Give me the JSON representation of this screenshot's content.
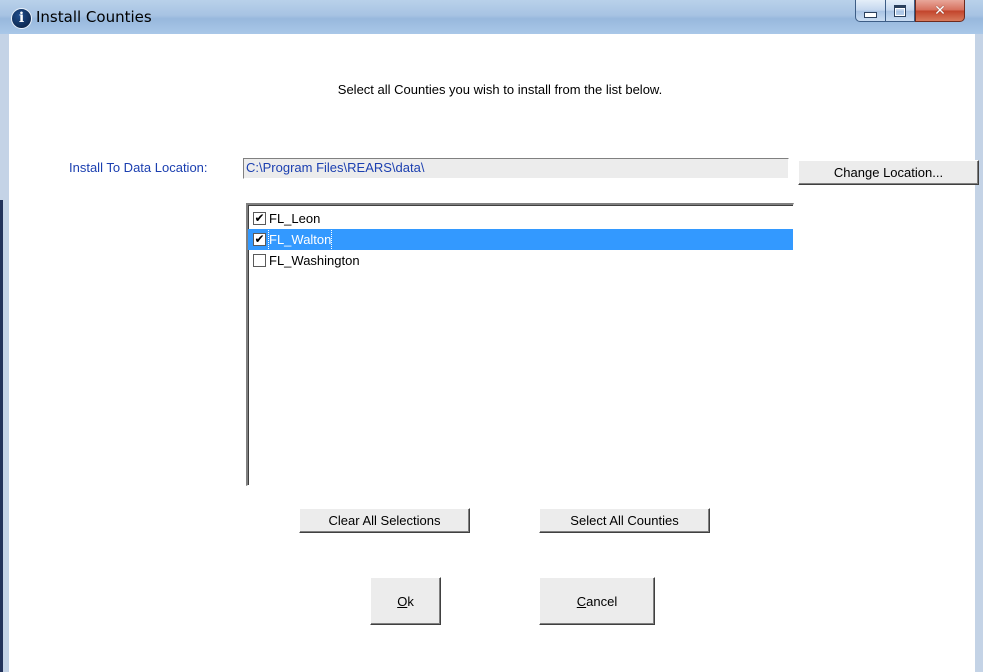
{
  "window": {
    "title": "Install Counties"
  },
  "instruction": "Select all Counties you wish to install from the list below.",
  "location": {
    "label": "Install To Data Location:",
    "value": "C:\\Program Files\\REARS\\data\\",
    "change_button": "Change Location..."
  },
  "counties": [
    {
      "label": "FL_Leon",
      "checked": true,
      "selected": false
    },
    {
      "label": "FL_Walton",
      "checked": true,
      "selected": true
    },
    {
      "label": "FL_Washington",
      "checked": false,
      "selected": false
    }
  ],
  "buttons": {
    "clear": "Clear All Selections",
    "select_all": "Select All Counties",
    "ok_mnemonic": "O",
    "ok_rest": "k",
    "cancel_mnemonic": "C",
    "cancel_rest": "ancel"
  },
  "colors": {
    "selection": "#3399ff",
    "label_blue": "#1b3fb0"
  },
  "icons": {
    "title": "info-icon",
    "minimize": "minimize-icon",
    "maximize": "maximize-icon",
    "close": "close-icon",
    "check": "checkmark-icon"
  }
}
